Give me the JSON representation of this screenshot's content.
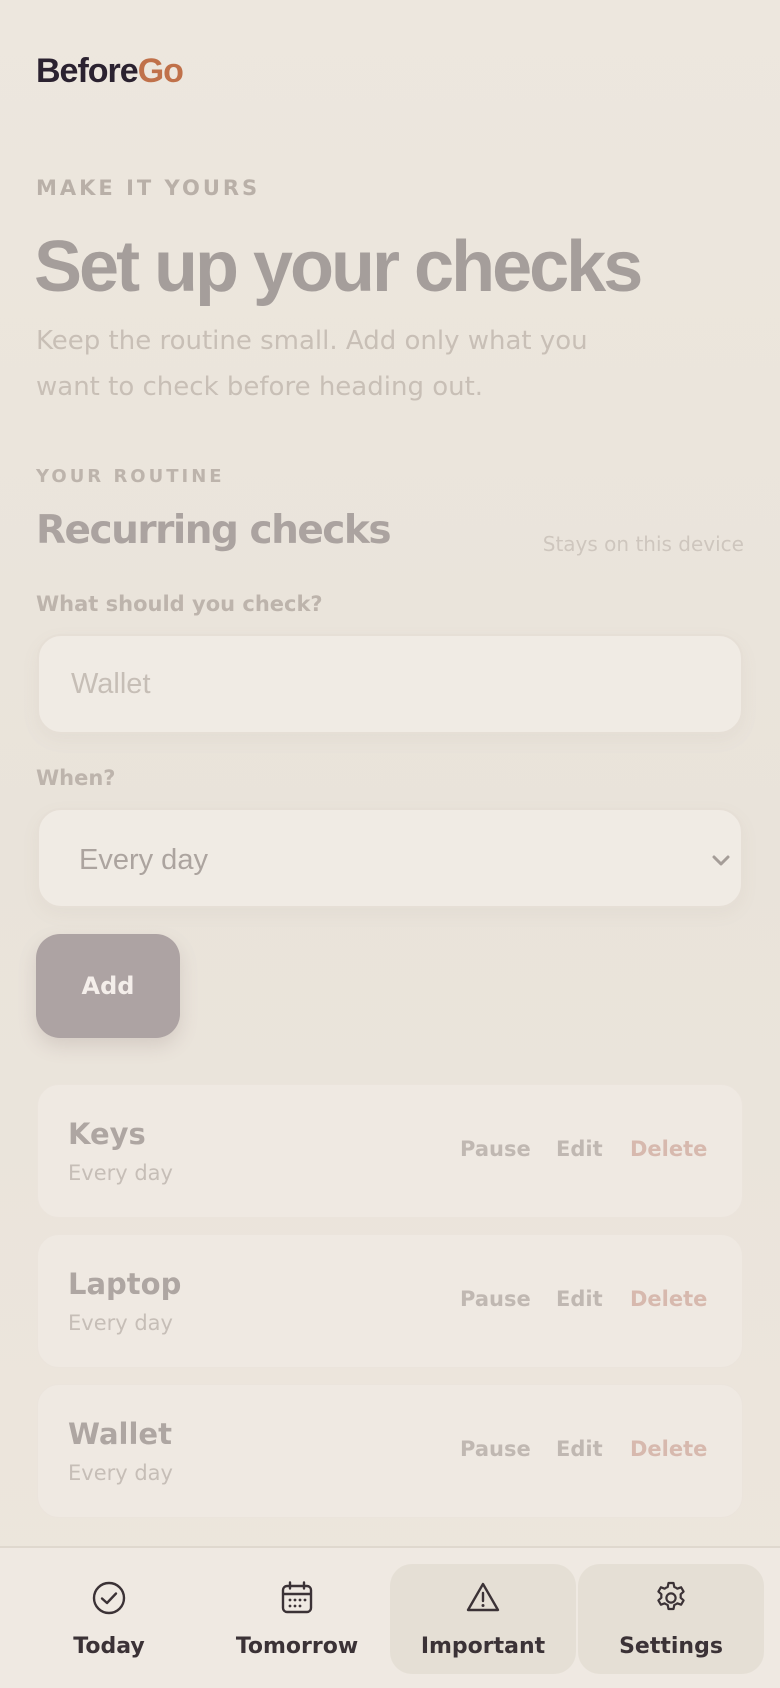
{
  "brand": {
    "part1": "Before",
    "part2": "Go"
  },
  "hero": {
    "eyebrow": "MAKE IT YOURS",
    "title": "Set up your checks",
    "subtitle": "Keep the routine small. Add only what you want to check before heading out."
  },
  "routine": {
    "eyebrow": "YOUR ROUTINE",
    "title": "Recurring checks",
    "note": "Stays on this device",
    "check_label": "What should you check?",
    "check_placeholder": "Wallet",
    "when_label": "When?",
    "when_value": "Every day",
    "add_label": "Add"
  },
  "checks": [
    {
      "name": "Keys",
      "schedule": "Every day"
    },
    {
      "name": "Laptop",
      "schedule": "Every day"
    },
    {
      "name": "Wallet",
      "schedule": "Every day"
    }
  ],
  "actions": {
    "pause": "Pause",
    "edit": "Edit",
    "delete": "Delete"
  },
  "nav": [
    {
      "label": "Today",
      "icon": "check-circle-icon"
    },
    {
      "label": "Tomorrow",
      "icon": "calendar-icon"
    },
    {
      "label": "Important",
      "icon": "warning-icon"
    },
    {
      "label": "Settings",
      "icon": "gear-icon"
    }
  ],
  "colors": {
    "brand_dark": "#2b2230",
    "brand_accent": "#c0714a",
    "delete": "#d7b9ae"
  }
}
